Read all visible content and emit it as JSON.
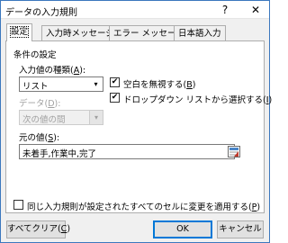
{
  "window": {
    "title": "データの入力規則",
    "help_glyph": "?",
    "close_glyph": "✕"
  },
  "tabs": [
    {
      "label": "設定",
      "active": true
    },
    {
      "label": "入力時メッセージ",
      "active": false
    },
    {
      "label": "エラー メッセージ",
      "active": false
    },
    {
      "label": "日本語入力",
      "active": false
    }
  ],
  "settings": {
    "section_title": "条件の設定",
    "allow_label": "入力値の種類(",
    "allow_key": "A",
    "allow_suffix": "):",
    "allow_value": "リスト",
    "data_label": "データ(",
    "data_key": "D",
    "data_suffix": "):",
    "data_value": "次の値の間",
    "ignore_blank": {
      "label": "空白を無視する(",
      "key": "B",
      "suffix": ")",
      "checked": true
    },
    "in_cell_dropdown": {
      "label": "ドロップダウン リストから選択する(",
      "key": "I",
      "suffix": ")",
      "checked": true
    },
    "source_label": "元の値(",
    "source_key": "S",
    "source_suffix": "):",
    "source_value": "未着手,作業中,完了",
    "apply_all": {
      "label": "同じ入力規則が設定されたすべてのセルに変更を適用する(",
      "key": "P",
      "suffix": ")",
      "checked": false
    }
  },
  "buttons": {
    "clear_label": "すべてクリア(",
    "clear_key": "C",
    "clear_suffix": ")",
    "ok_label": "OK",
    "cancel_label": "キャンセル"
  },
  "glyphs": {
    "check": "✔",
    "dropdown": "▾"
  },
  "colors": {
    "window_border": "#3c78be",
    "default_button_border": "#0078d7",
    "dialog_background": "#f0f0f0"
  }
}
